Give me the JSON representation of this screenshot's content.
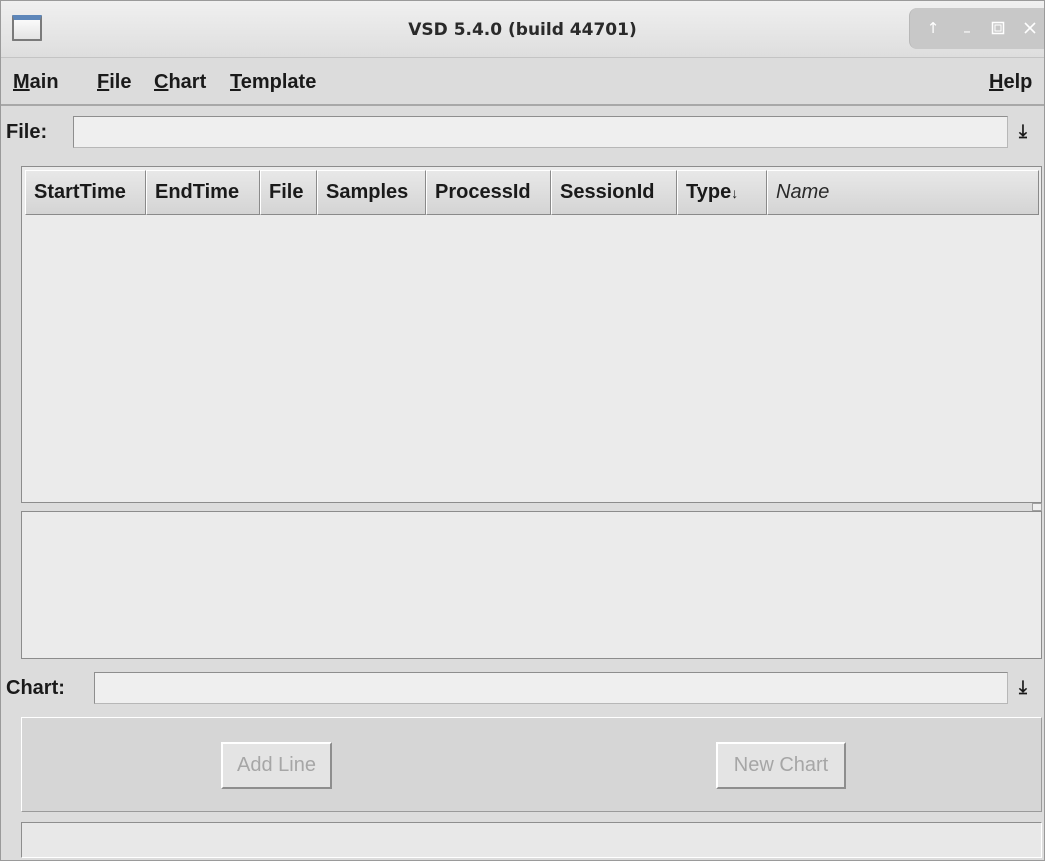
{
  "window": {
    "title": "VSD 5.4.0 (build 44701)",
    "controls": {
      "shade_icon": "up-arrow-icon",
      "minimize_icon": "minimize-icon",
      "maximize_icon": "maximize-icon",
      "close_icon": "close-icon"
    }
  },
  "menubar": {
    "main": {
      "mnemonic": "M",
      "rest": "ain"
    },
    "file": {
      "mnemonic": "F",
      "rest": "ile"
    },
    "chart": {
      "mnemonic": "C",
      "rest": "hart"
    },
    "template": {
      "mnemonic": "T",
      "rest": "emplate"
    },
    "help": {
      "mnemonic": "H",
      "rest": "elp"
    }
  },
  "file_row": {
    "label": "File:",
    "value": "",
    "dropdown_icon": "down-to-bar-arrow-icon"
  },
  "table": {
    "columns": [
      {
        "label": "StartTime"
      },
      {
        "label": "EndTime"
      },
      {
        "label": "File"
      },
      {
        "label": "Samples"
      },
      {
        "label": "ProcessId"
      },
      {
        "label": "SessionId"
      },
      {
        "label": "Type",
        "sort_indicator": "↓"
      },
      {
        "label": "Name"
      }
    ],
    "rows": []
  },
  "chart_row": {
    "label": "Chart:",
    "value": "",
    "dropdown_icon": "down-to-bar-arrow-icon"
  },
  "buttons": {
    "add_line": {
      "label": "Add Line",
      "enabled": false
    },
    "new_chart": {
      "label": "New Chart",
      "enabled": false
    }
  },
  "statusbar": {
    "text": ""
  },
  "colors": {
    "window_bg": "#dcdcdc",
    "panel_bg": "#ebebeb",
    "disabled_text": "#a6a6a6",
    "title_bar_icon_accent": "#5d86b9"
  }
}
